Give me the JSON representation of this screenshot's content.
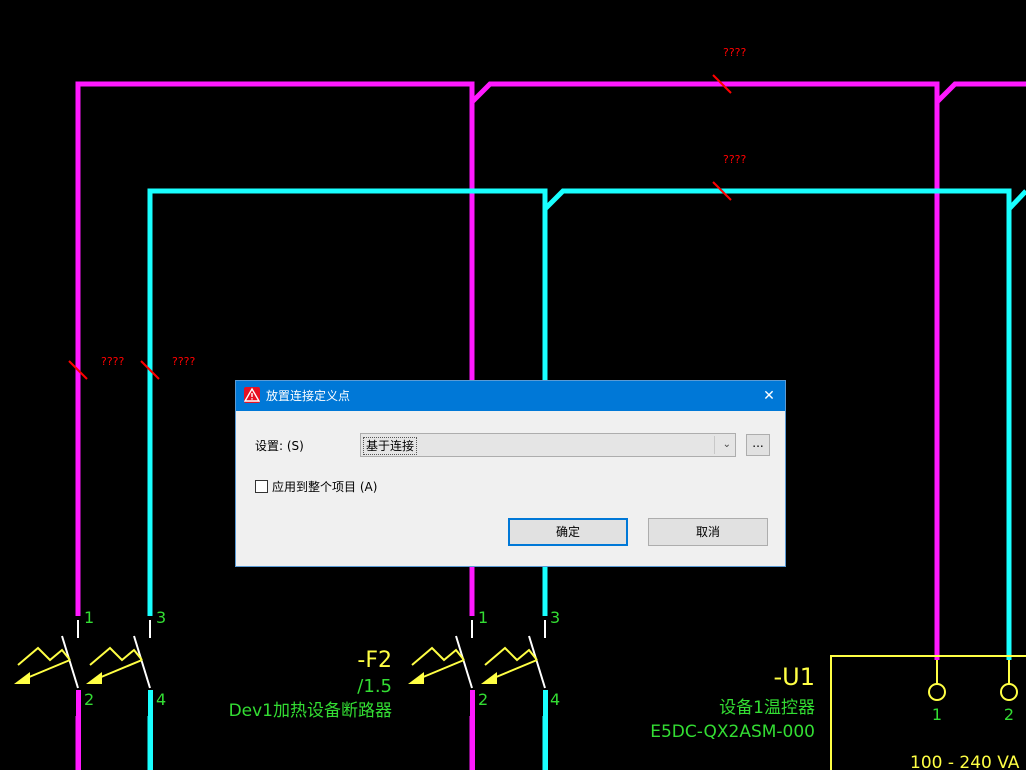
{
  "schematic": {
    "cut_labels": [
      "????",
      "????",
      "????",
      "????"
    ],
    "pin_labels": [
      "1",
      "3",
      "2",
      "4",
      "1",
      "3",
      "2",
      "4",
      "1",
      "2"
    ],
    "f2": {
      "tag": "-F2",
      "ref": "/1.5",
      "desc": "Dev1加热设备断路器"
    },
    "u1": {
      "tag": "-U1",
      "desc": "设备1温控器",
      "part": "E5DC-QX2ASM-000",
      "rating": "100 - 240 VA"
    },
    "colors": {
      "phase_l": "#ff19ff",
      "phase_n": "#19ffff",
      "green_text": "#33dd33",
      "yellow": "#ffff44",
      "red": "#ff0000",
      "background": "#000000"
    }
  },
  "dialog": {
    "title": "放置连接定义点",
    "settings_label": "设置: (S)",
    "settings_value": "基于连接",
    "more_button": "...",
    "apply_all_label": "应用到整个项目 (A)",
    "apply_all_checked": false,
    "ok_label": "确定",
    "cancel_label": "取消",
    "close_glyph": "✕"
  }
}
